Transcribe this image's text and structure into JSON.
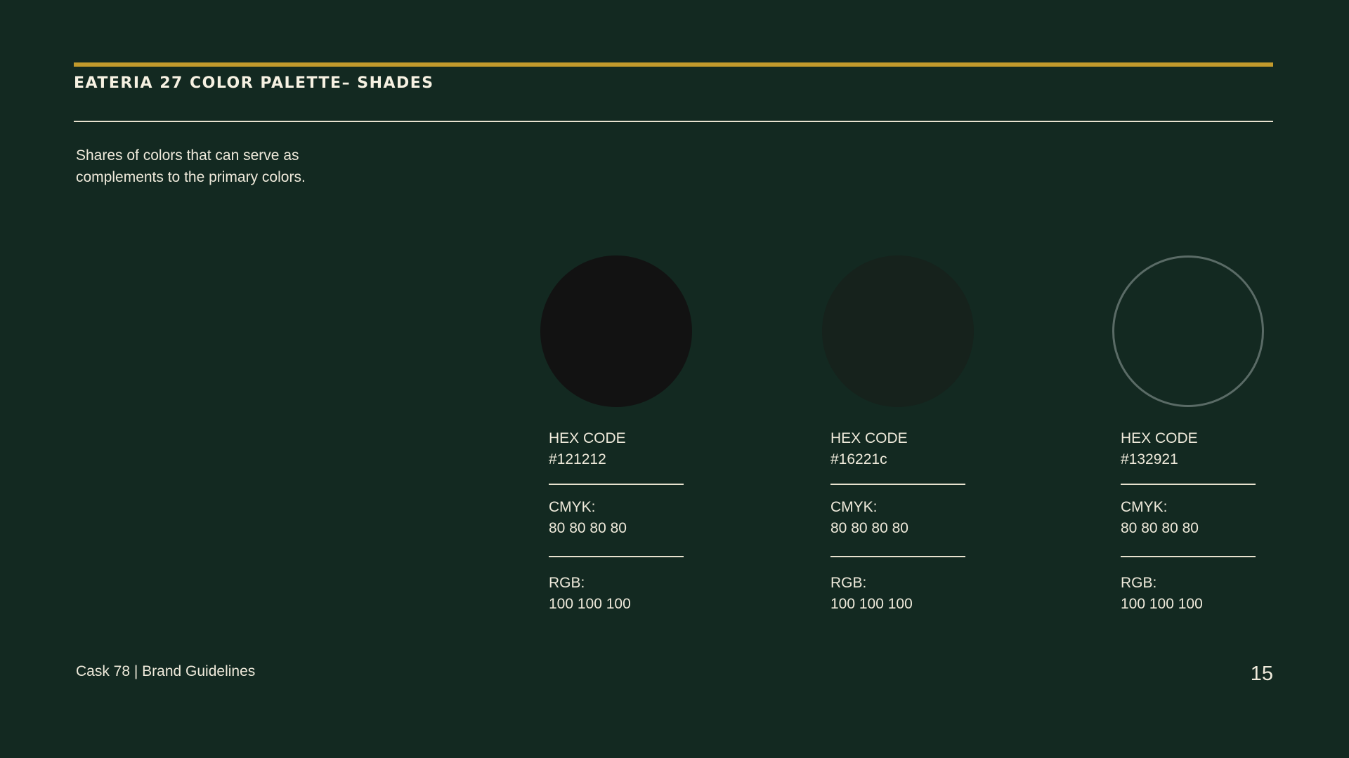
{
  "header": {
    "title": "EATERIA 27 COLOR PALETTE– SHADES",
    "accent_color": "#c29a2c"
  },
  "intro": {
    "line1": "Shares of colors that can serve as",
    "line2": "complements to the primary colors."
  },
  "swatches": [
    {
      "color": "#121212",
      "hex_label": "HEX CODE",
      "hex_value": "#121212",
      "cmyk_label": "CMYK:",
      "cmyk_value": "80 80 80 80",
      "rgb_label": "RGB:",
      "rgb_value": "100 100 100"
    },
    {
      "color": "#16221c",
      "hex_label": "HEX CODE",
      "hex_value": "#16221c",
      "cmyk_label": "CMYK:",
      "cmyk_value": "80 80 80 80",
      "rgb_label": "RGB:",
      "rgb_value": "100 100 100"
    },
    {
      "color": "#132921",
      "outline_color": "#5a6b66",
      "hex_label": "HEX CODE",
      "hex_value": "#132921",
      "cmyk_label": "CMYK:",
      "cmyk_value": "80 80 80 80",
      "rgb_label": "RGB:",
      "rgb_value": "100 100 100"
    }
  ],
  "footer": {
    "text": "Cask 78 | Brand Guidelines",
    "page_number": "15"
  }
}
